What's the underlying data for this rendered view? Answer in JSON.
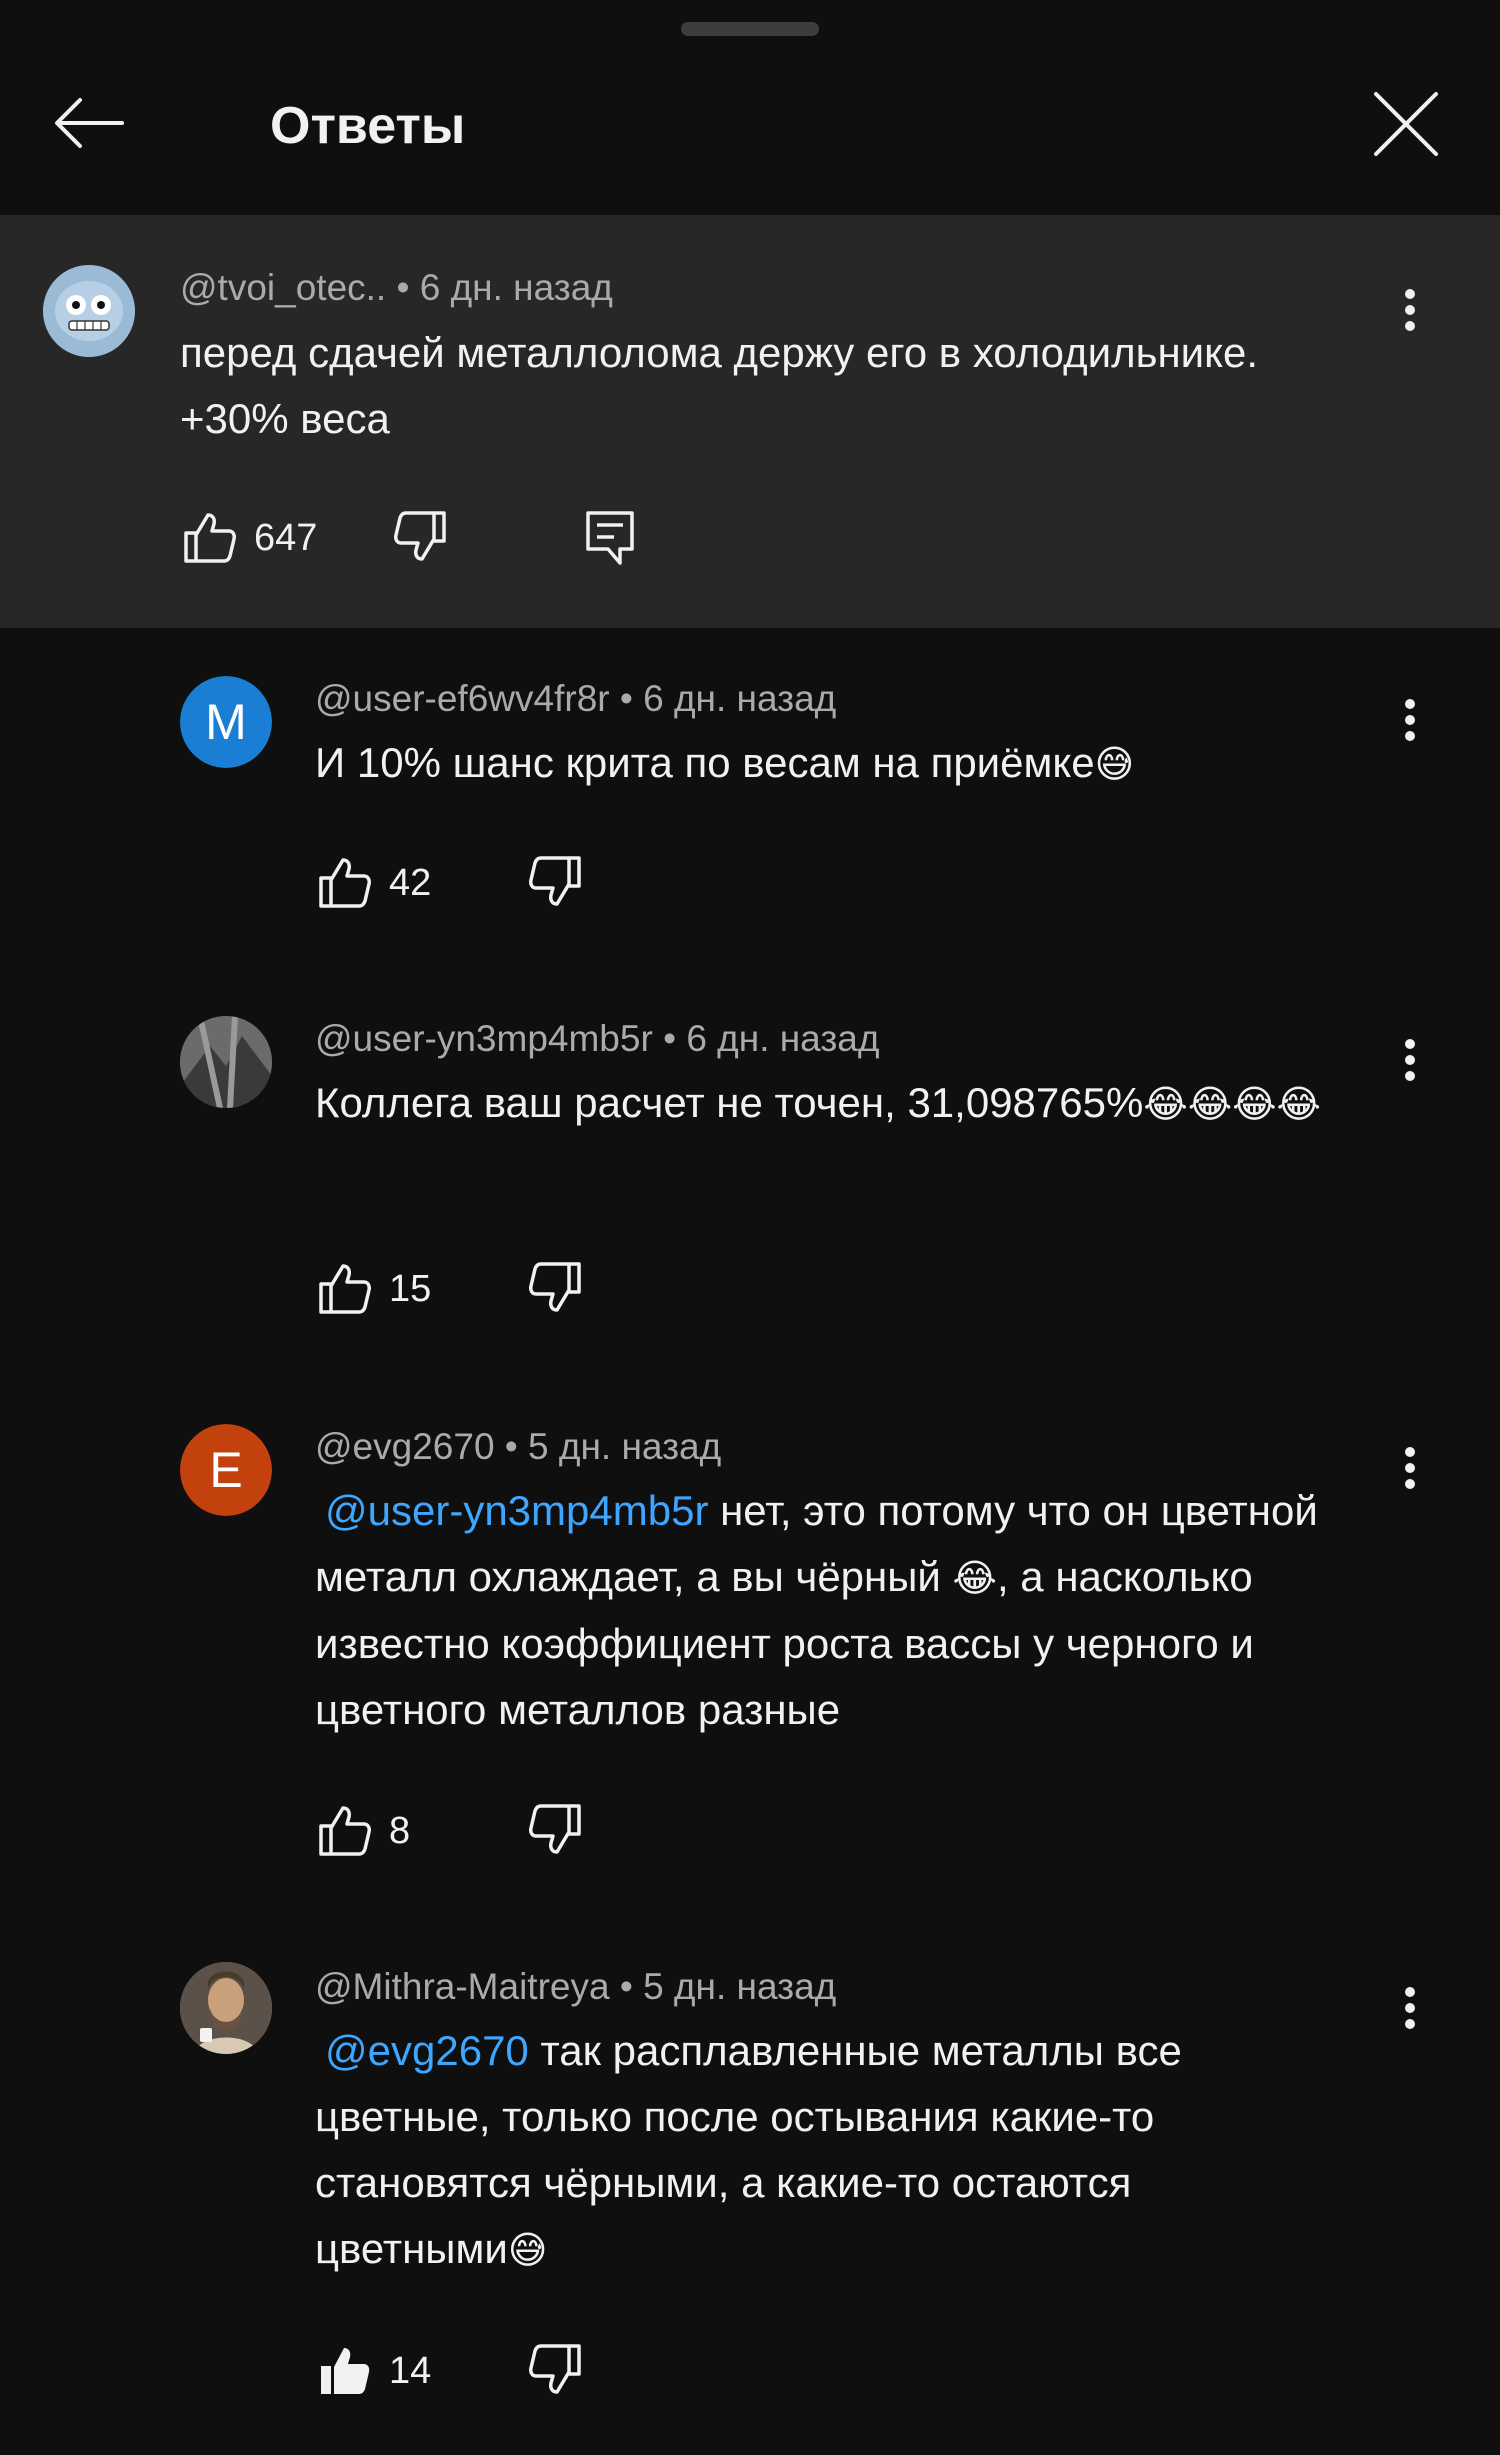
{
  "header": {
    "title": "Ответы",
    "back_icon": "arrow-left-icon",
    "close_icon": "close-icon"
  },
  "parent_comment": {
    "author": "@tvoi_otec..",
    "time": "6 дн. назад",
    "text": "перед сдачей металлолома держу его в холодильнике. +30% веса",
    "likes": "647"
  },
  "replies": [
    {
      "author": "@user-ef6wv4fr8r",
      "time": "6 дн. назад",
      "avatar_letter": "M",
      "avatar_color": "#1a7fd4",
      "text": "И 10% шанс крита по весам на приёмке",
      "emoji": "😅",
      "likes": "42"
    },
    {
      "author": "@user-yn3mp4mb5r",
      "time": "6 дн. назад",
      "text": "Коллега ваш расчет не точен, 31,098765%",
      "emoji": "😂😂😂😂",
      "likes": "15"
    },
    {
      "author": "@evg2670",
      "time": "5 дн. назад",
      "avatar_letter": "E",
      "avatar_color": "#c2410c",
      "mention": "@user-yn3mp4mb5r",
      "text_a": " нет, это потому что он цветной металл охлаждает, а вы чёрный ",
      "emoji": "😂",
      "text_b": ", а насколько известно коэффициент роста вассы у черного и цветного металлов разные",
      "likes": "8"
    },
    {
      "author": "@Mithra-Maitreya",
      "time": "5 дн. назад",
      "mention": "@evg2670",
      "text": " так расплавленные металлы все цветные, только после остывания какие-то становятся чёрными, а какие-то остаются цветными",
      "emoji": "😅",
      "likes": "14"
    }
  ],
  "separator": " • "
}
